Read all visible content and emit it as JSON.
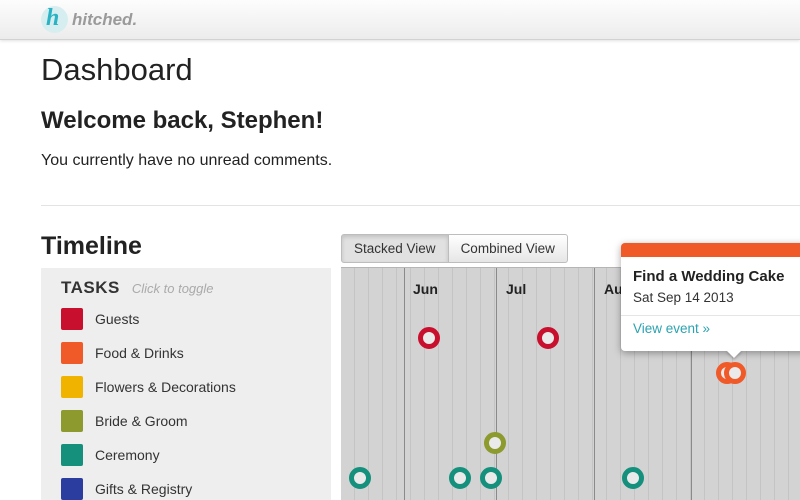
{
  "brand": {
    "name": "hitched.",
    "mark": "h"
  },
  "page": {
    "title": "Dashboard",
    "welcome": "Welcome back, Stephen!",
    "comments": "You currently have no unread comments."
  },
  "timeline": {
    "title": "Timeline",
    "legend": {
      "heading": "TASKS",
      "hint": "Click to toggle",
      "items": [
        {
          "label": "Guests",
          "color": "#c8102e"
        },
        {
          "label": "Food & Drinks",
          "color": "#f05a28"
        },
        {
          "label": "Flowers & Decorations",
          "color": "#f0b400"
        },
        {
          "label": "Bride & Groom",
          "color": "#8c9a2e"
        },
        {
          "label": "Ceremony",
          "color": "#14907d"
        },
        {
          "label": "Gifts & Registry",
          "color": "#2b3ea0"
        }
      ]
    },
    "views": {
      "stacked": "Stacked View",
      "combined": "Combined View",
      "active": "stacked"
    },
    "months": [
      "Jun",
      "Jul",
      "Au"
    ]
  },
  "popup": {
    "title": "Find a Wedding Cake",
    "date": "Sat Sep 14 2013",
    "link": "View event »",
    "accent": "#f05a28"
  }
}
